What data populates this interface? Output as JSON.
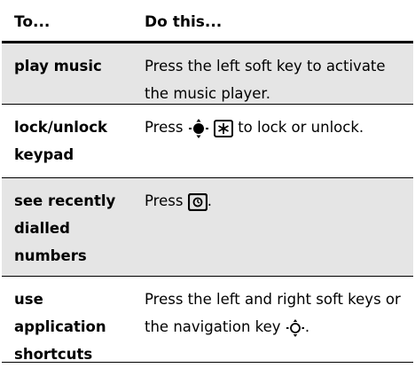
{
  "table": {
    "header": {
      "col1": "To...",
      "col2": "Do this..."
    },
    "rows": [
      {
        "term": "play music",
        "desc_parts": [
          "Press the left soft key to activate the music player."
        ]
      },
      {
        "term": "lock/unlock keypad",
        "desc_parts": [
          "Press",
          "to lock or unlock."
        ]
      },
      {
        "term": "see recently dialled numbers",
        "desc_parts": [
          "Press",
          "."
        ]
      },
      {
        "term": "use application shortcuts",
        "desc_parts": [
          "Press the left and right soft keys or the navigation key",
          "."
        ]
      }
    ]
  },
  "icons": {
    "row2_a": "nav-key-center-filled-icon",
    "row2_b": "star-key-icon",
    "row3": "send-key-icon",
    "row4": "nav-key-center-outline-icon"
  }
}
